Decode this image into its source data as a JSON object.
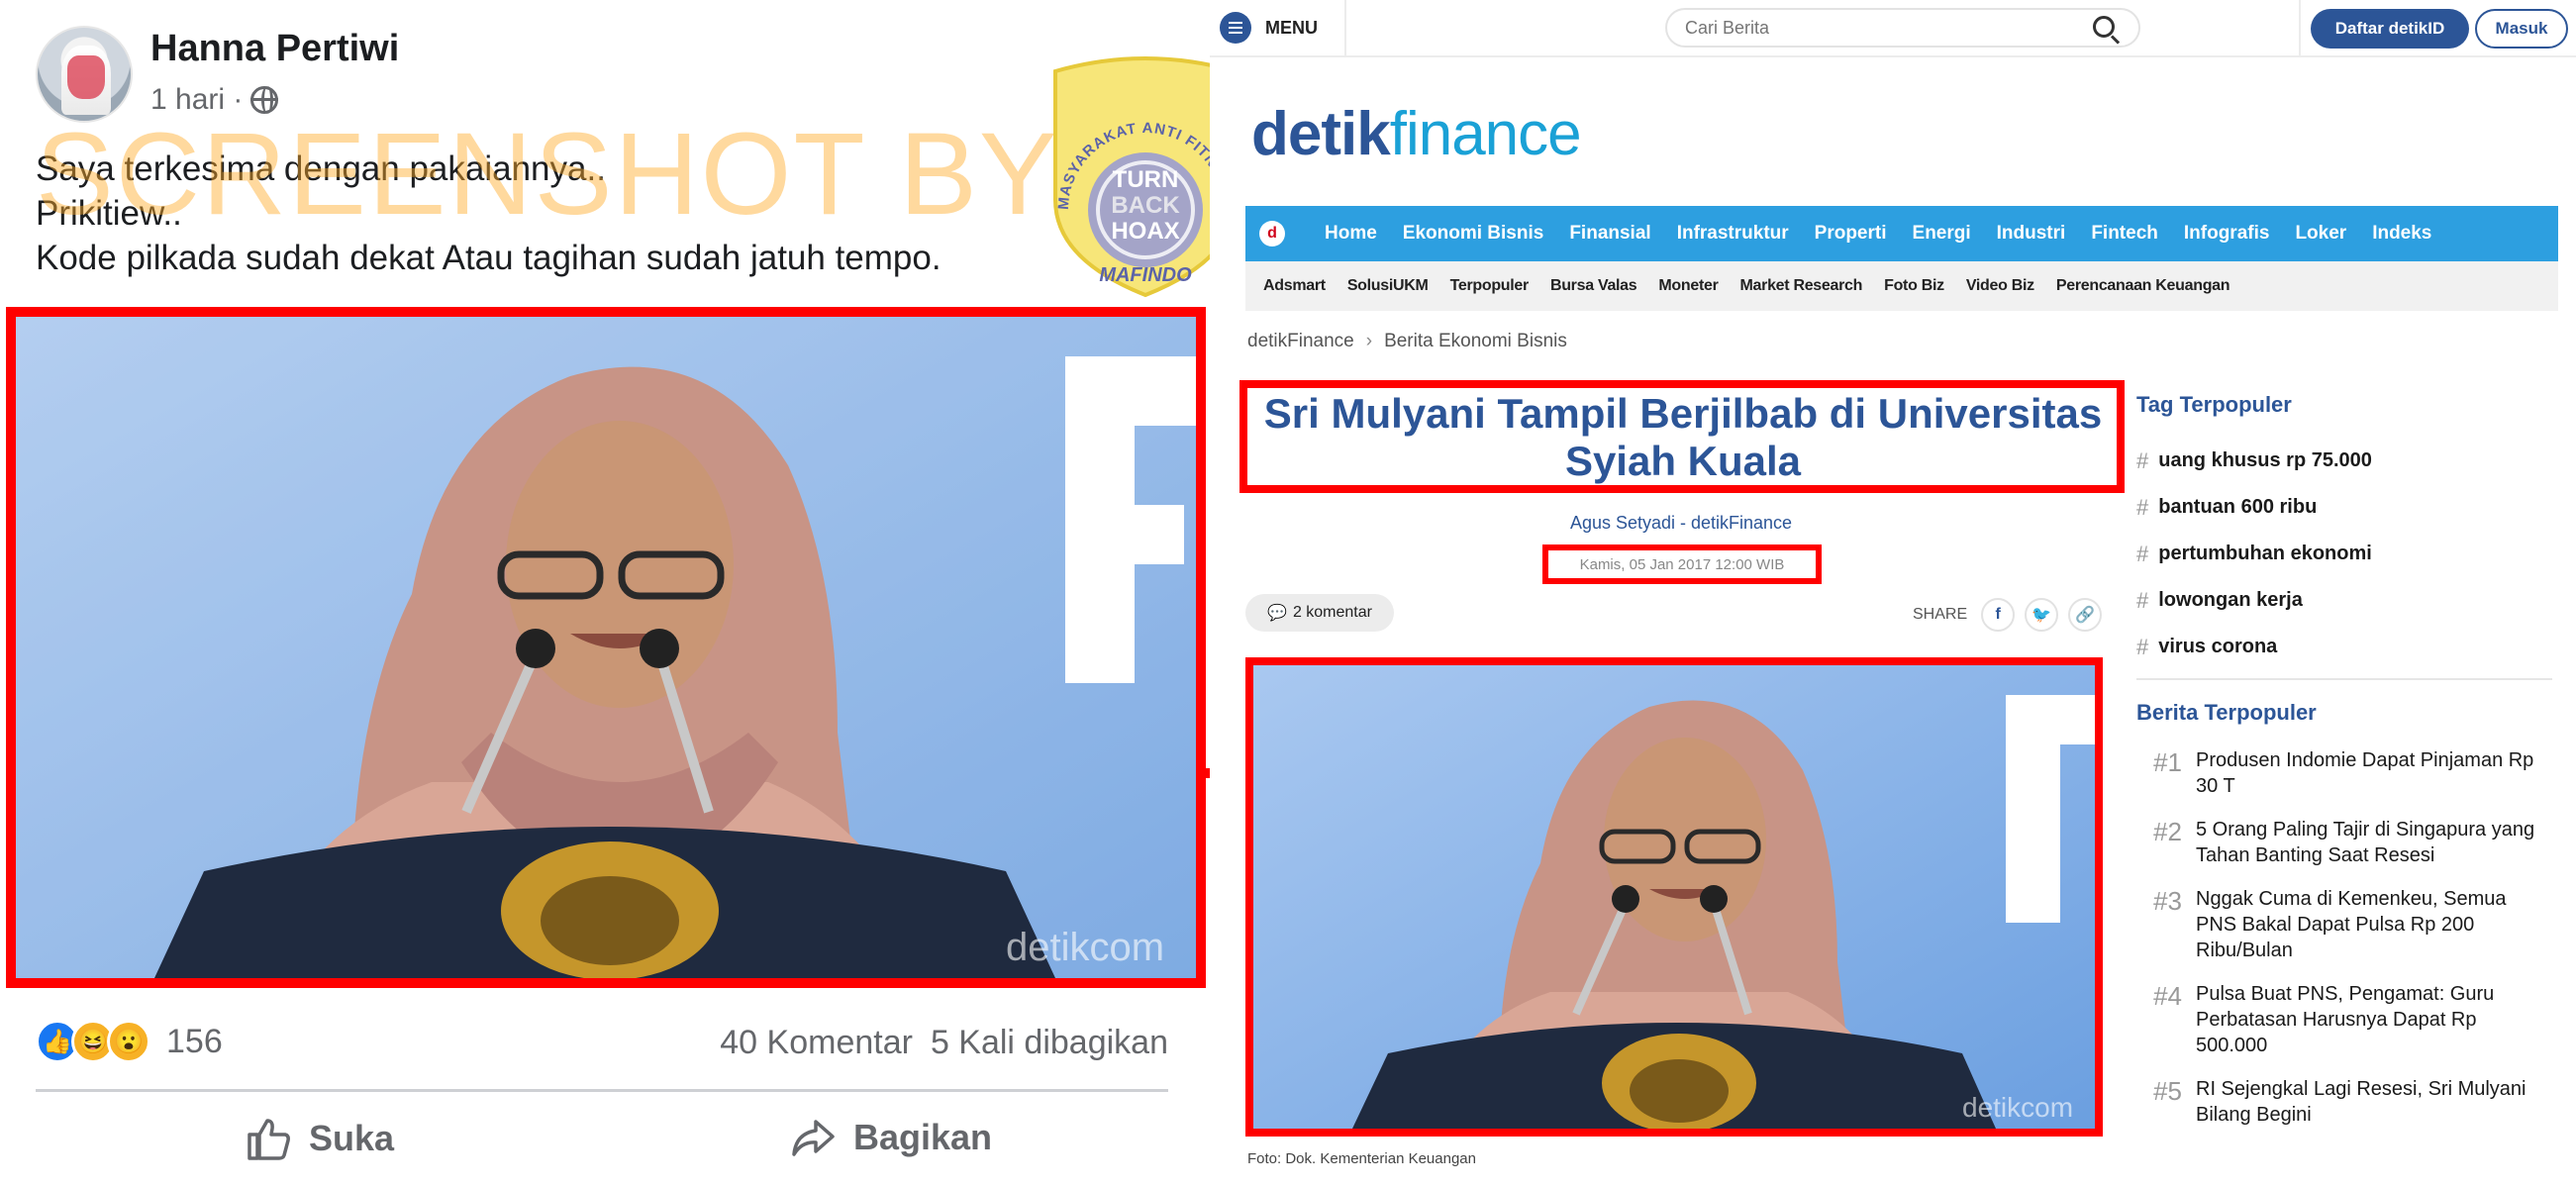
{
  "facebook": {
    "author": "Hanna Pertiwi",
    "time": "1 hari ·",
    "watermark": "SCREENSHOT BY",
    "text_lines": [
      "Saya terkesima dengan pakaiannya..",
      "Prikitiew..",
      "Kode pilkada sudah dekat Atau tagihan sudah jatuh tempo."
    ],
    "photo_watermark": "detikcom",
    "reaction_count": "156",
    "comments": "40 Komentar",
    "shares": "5 Kali dibagikan",
    "like_label": "Suka",
    "share_label": "Bagikan"
  },
  "stamp": {
    "ring_text": "MASYARAKAT ANTI FITNAH INDONESIA",
    "center_lines": [
      "TURN",
      "BACK",
      "HOAX"
    ],
    "bottom_text": "MAFINDO"
  },
  "detik": {
    "menu_label": "MENU",
    "search_placeholder": "Cari Berita",
    "register_label": "Daftar detikID",
    "login_label": "Masuk",
    "logo_part1": "detik",
    "logo_part2": "finance",
    "nav_icon": "d",
    "nav_primary": [
      "Home",
      "Ekonomi Bisnis",
      "Finansial",
      "Infrastruktur",
      "Properti",
      "Energi",
      "Industri",
      "Fintech",
      "Infografis",
      "Loker",
      "Indeks"
    ],
    "nav_secondary": [
      "Adsmart",
      "SolusiUKM",
      "Terpopuler",
      "Bursa Valas",
      "Moneter",
      "Market Research",
      "Foto Biz",
      "Video Biz",
      "Perencanaan Keuangan"
    ],
    "breadcrumb": [
      "detikFinance",
      "Berita Ekonomi Bisnis"
    ],
    "article_title": "Sri Mulyani Tampil Berjilbab di Universitas Syiah Kuala",
    "article_author": "Agus Setyadi - detikFinance",
    "article_date": "Kamis, 05 Jan 2017 12:00 WIB",
    "comments_label": "2 komentar",
    "share_label": "SHARE",
    "photo_watermark": "detikcom",
    "photo_caption": "Foto: Dok. Kementerian Keuangan",
    "tag_heading": "Tag Terpopuler",
    "tags": [
      "uang khusus rp 75.000",
      "bantuan 600 ribu",
      "pertumbuhan ekonomi",
      "lowongan kerja",
      "virus corona"
    ],
    "berita_heading": "Berita Terpopuler",
    "berita": [
      {
        "num": "#1",
        "title": "Produsen Indomie Dapat Pinjaman Rp 30 T"
      },
      {
        "num": "#2",
        "title": "5 Orang Paling Tajir di Singapura yang Tahan Banting Saat Resesi"
      },
      {
        "num": "#3",
        "title": "Nggak Cuma di Kemenkeu, Semua PNS Bakal Dapat Pulsa Rp 200 Ribu/Bulan"
      },
      {
        "num": "#4",
        "title": "Pulsa Buat PNS, Pengamat: Guru Perbatasan Harusnya Dapat Rp 500.000"
      },
      {
        "num": "#5",
        "title": "RI Sejengkal Lagi Resesi, Sri Mulyani Bilang Begini"
      }
    ]
  },
  "colors": {
    "highlight": "#ff0000",
    "detik_blue": "#2c5597",
    "detik_cyan": "#2d9fe0",
    "fb_like": "#1877f2"
  }
}
